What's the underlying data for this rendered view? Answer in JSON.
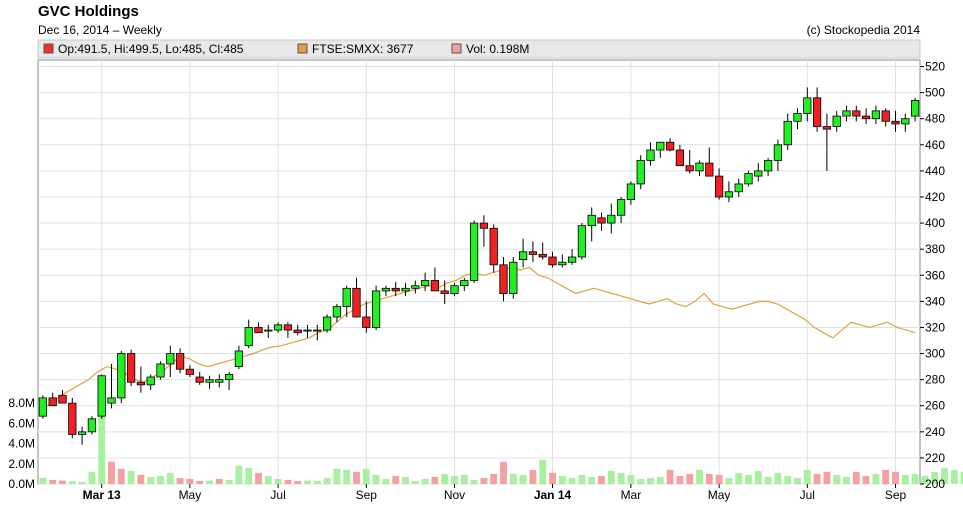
{
  "title": "GVC Holdings",
  "subtitle": "Dec 16, 2014 – Weekly",
  "copyright": "(c) Stockopedia 2014",
  "legend": [
    {
      "label": "Op:491.5, Hi:499.5, Lo:485, Cl:485",
      "color": "#e83232"
    },
    {
      "label": "FTSE:SMXX: 3677",
      "color": "#e0a040"
    },
    {
      "label": "Vol: 0.198M",
      "color": "#f4a0a0"
    }
  ],
  "chart_data": {
    "type": "candlestick",
    "y_axis": {
      "side": "right",
      "min": 200,
      "max": 525,
      "ticks": [
        200,
        220,
        240,
        260,
        280,
        300,
        320,
        340,
        360,
        380,
        400,
        420,
        440,
        460,
        480,
        500,
        520
      ]
    },
    "volume_axis": {
      "side": "left",
      "unit": "M",
      "min": 0,
      "max": 8,
      "ticks": [
        "0.0M",
        "2.0M",
        "4.0M",
        "6.0M",
        "8.0M"
      ]
    },
    "x_ticks": [
      {
        "label": "Mar 13",
        "index": 6,
        "bold": true
      },
      {
        "label": "May",
        "index": 15
      },
      {
        "label": "Jul",
        "index": 24
      },
      {
        "label": "Sep",
        "index": 33
      },
      {
        "label": "Nov",
        "index": 42
      },
      {
        "label": "Jan 14",
        "index": 52,
        "bold": true
      },
      {
        "label": "Mar",
        "index": 60
      },
      {
        "label": "May",
        "index": 69
      },
      {
        "label": "Jul",
        "index": 78
      },
      {
        "label": "Sep",
        "index": 87
      },
      {
        "label": "Nov",
        "index": 96
      }
    ],
    "candles": [
      [
        252,
        268,
        250,
        266
      ],
      [
        266,
        270,
        262,
        260
      ],
      [
        268,
        272,
        262,
        262
      ],
      [
        262,
        266,
        235,
        238
      ],
      [
        238,
        244,
        230,
        240
      ],
      [
        240,
        252,
        238,
        250
      ],
      [
        252,
        284,
        250,
        283
      ],
      [
        262,
        292,
        258,
        266
      ],
      [
        266,
        302,
        262,
        300
      ],
      [
        300,
        303,
        275,
        278
      ],
      [
        278,
        290,
        270,
        276
      ],
      [
        276,
        284,
        272,
        282
      ],
      [
        282,
        294,
        280,
        292
      ],
      [
        292,
        306,
        282,
        300
      ],
      [
        300,
        304,
        285,
        288
      ],
      [
        288,
        291,
        282,
        284
      ],
      [
        282,
        286,
        276,
        278
      ],
      [
        278,
        283,
        273,
        280
      ],
      [
        278,
        284,
        274,
        280
      ],
      [
        280,
        286,
        272,
        284
      ],
      [
        290,
        306,
        288,
        302
      ],
      [
        306,
        326,
        304,
        320
      ],
      [
        320,
        324,
        316,
        316
      ],
      [
        318,
        322,
        312,
        318
      ],
      [
        318,
        324,
        316,
        322
      ],
      [
        322,
        324,
        312,
        318
      ],
      [
        318,
        322,
        314,
        316
      ],
      [
        318,
        322,
        312,
        318
      ],
      [
        318,
        322,
        310,
        318
      ],
      [
        318,
        330,
        316,
        328
      ],
      [
        328,
        338,
        324,
        336
      ],
      [
        336,
        352,
        328,
        350
      ],
      [
        350,
        358,
        330,
        328
      ],
      [
        328,
        340,
        316,
        320
      ],
      [
        320,
        352,
        318,
        348
      ],
      [
        348,
        352,
        344,
        350
      ],
      [
        350,
        355,
        344,
        348
      ],
      [
        348,
        354,
        344,
        350
      ],
      [
        350,
        356,
        346,
        352
      ],
      [
        352,
        362,
        348,
        356
      ],
      [
        356,
        366,
        350,
        348
      ],
      [
        348,
        356,
        338,
        346
      ],
      [
        346,
        354,
        344,
        352
      ],
      [
        352,
        358,
        348,
        356
      ],
      [
        356,
        402,
        354,
        400
      ],
      [
        400,
        406,
        382,
        396
      ],
      [
        396,
        399,
        362,
        368
      ],
      [
        368,
        374,
        340,
        346
      ],
      [
        346,
        374,
        342,
        370
      ],
      [
        372,
        388,
        366,
        378
      ],
      [
        378,
        386,
        370,
        376
      ],
      [
        376,
        385,
        372,
        374
      ],
      [
        374,
        378,
        366,
        368
      ],
      [
        368,
        376,
        366,
        370
      ],
      [
        370,
        380,
        368,
        374
      ],
      [
        374,
        400,
        372,
        398
      ],
      [
        398,
        412,
        386,
        406
      ],
      [
        404,
        408,
        394,
        400
      ],
      [
        400,
        415,
        392,
        406
      ],
      [
        406,
        420,
        400,
        418
      ],
      [
        418,
        432,
        414,
        430
      ],
      [
        430,
        452,
        426,
        448
      ],
      [
        448,
        462,
        444,
        456
      ],
      [
        456,
        462,
        450,
        462
      ],
      [
        462,
        465,
        455,
        456
      ],
      [
        456,
        460,
        446,
        444
      ],
      [
        444,
        456,
        438,
        440
      ],
      [
        440,
        448,
        436,
        446
      ],
      [
        446,
        458,
        440,
        436
      ],
      [
        436,
        442,
        418,
        420
      ],
      [
        420,
        432,
        416,
        424
      ],
      [
        424,
        434,
        420,
        430
      ],
      [
        430,
        440,
        428,
        438
      ],
      [
        436,
        446,
        432,
        440
      ],
      [
        440,
        450,
        436,
        448
      ],
      [
        448,
        464,
        440,
        460
      ],
      [
        460,
        484,
        456,
        478
      ],
      [
        478,
        488,
        472,
        484
      ],
      [
        484,
        504,
        478,
        496
      ],
      [
        496,
        504,
        470,
        474
      ],
      [
        474,
        484,
        440,
        472
      ],
      [
        474,
        486,
        470,
        482
      ],
      [
        482,
        490,
        478,
        486
      ],
      [
        486,
        490,
        478,
        482
      ],
      [
        482,
        488,
        476,
        480
      ],
      [
        480,
        490,
        476,
        486
      ],
      [
        486,
        488,
        474,
        478
      ],
      [
        478,
        486,
        470,
        476
      ],
      [
        476,
        484,
        470,
        480
      ],
      [
        482,
        496,
        478,
        494
      ]
    ],
    "volume": [
      0.6,
      0.4,
      0.35,
      0.3,
      0.2,
      1.2,
      7.2,
      2.2,
      1.5,
      1.3,
      0.9,
      0.7,
      0.8,
      1.1,
      0.6,
      0.5,
      0.3,
      0.35,
      0.5,
      0.4,
      1.8,
      1.6,
      1.1,
      0.8,
      0.5,
      0.4,
      0.3,
      0.35,
      0.3,
      0.6,
      1.5,
      1.4,
      1.2,
      1.5,
      0.9,
      0.5,
      0.8,
      0.7,
      0.3,
      0.5,
      0.7,
      1.0,
      0.8,
      0.9,
      0.4,
      0.6,
      1.0,
      2.2,
      1.0,
      0.9,
      1.4,
      2.4,
      1.1,
      0.8,
      0.6,
      0.9,
      0.7,
      0.8,
      1.3,
      1.1,
      0.9,
      0.5,
      0.6,
      0.7,
      1.4,
      0.8,
      1.0,
      1.4,
      1.0,
      0.9,
      0.6,
      1.1,
      0.9,
      1.3,
      0.7,
      1.1,
      0.8,
      0.6,
      1.4,
      1.0,
      1.2,
      0.9,
      0.7,
      1.2,
      0.8,
      1.0,
      1.4,
      1.2,
      0.9,
      1.0,
      0.8,
      1.2,
      1.6,
      1.4,
      1.2,
      0.9,
      1.1,
      0.7,
      0.9,
      1.0
    ],
    "volume_colors": [
      "g",
      "r",
      "r",
      "g",
      "g",
      "g",
      "g",
      "r",
      "r",
      "g",
      "r",
      "g",
      "g",
      "g",
      "r",
      "r",
      "r",
      "g",
      "r",
      "g",
      "g",
      "g",
      "r",
      "g",
      "g",
      "r",
      "r",
      "g",
      "g",
      "g",
      "g",
      "g",
      "r",
      "g",
      "g",
      "g",
      "r",
      "g",
      "g",
      "g",
      "r",
      "g",
      "g",
      "g",
      "g",
      "r",
      "r",
      "r",
      "g",
      "g",
      "r",
      "g",
      "r",
      "g",
      "g",
      "g",
      "g",
      "r",
      "g",
      "g",
      "g",
      "g",
      "g",
      "g",
      "r",
      "r",
      "r",
      "g",
      "r",
      "r",
      "g",
      "g",
      "g",
      "g",
      "g",
      "g",
      "g",
      "g",
      "g",
      "r",
      "r",
      "g",
      "g",
      "r",
      "r",
      "g",
      "r",
      "r",
      "g",
      "g",
      "g",
      "g",
      "g",
      "g",
      "g",
      "g",
      "g",
      "r",
      "r",
      "r"
    ],
    "ftse_line": [
      258,
      262,
      268,
      272,
      276,
      280,
      286,
      290,
      288,
      285,
      280,
      278,
      282,
      286,
      292,
      298,
      296,
      292,
      290,
      292,
      294,
      296,
      298,
      300,
      303,
      305,
      306,
      308,
      310,
      312,
      316,
      318,
      324,
      330,
      334,
      338,
      340,
      342,
      344,
      346,
      348,
      350,
      352,
      350,
      354,
      356,
      360,
      362,
      360,
      362,
      364,
      366,
      364,
      366,
      360,
      358,
      354,
      350,
      346,
      348,
      350,
      348,
      346,
      344,
      342,
      340,
      338,
      340,
      342,
      338,
      336,
      340,
      346,
      338,
      336,
      334,
      336,
      338,
      340,
      340,
      338,
      334,
      330,
      326,
      320,
      316,
      312,
      318,
      324,
      322,
      320,
      322,
      324,
      320,
      318,
      316
    ],
    "last_candle": {
      "open": 491.5,
      "high": 499.5,
      "low": 485,
      "close": 485
    }
  }
}
